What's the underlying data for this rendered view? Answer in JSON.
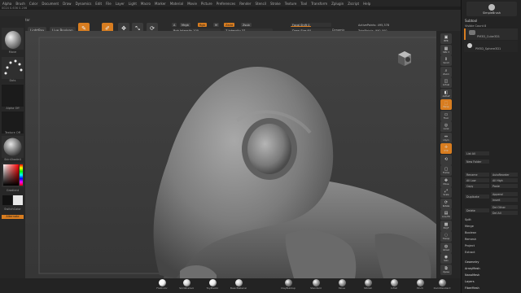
{
  "menubar": [
    "Alpha",
    "Brush",
    "Color",
    "Document",
    "Draw",
    "Dynamics",
    "Edit",
    "File",
    "Layer",
    "Light",
    "Macro",
    "Marker",
    "Material",
    "Movie",
    "Picture",
    "Preferences",
    "Render",
    "Stencil",
    "Stroke",
    "Texture",
    "Tool",
    "Transform",
    "Zplugin",
    "Zscript",
    "Help"
  ],
  "subinfo": "0024 0.636 0.206",
  "shelf": {
    "projection": "Projection Master",
    "lightbox": "LightBox",
    "live_boolean": "Live Boolean",
    "tools": [
      {
        "label": "Edit",
        "icon": "✎",
        "on": true
      },
      {
        "label": "Draw",
        "icon": "✐",
        "on": true
      },
      {
        "label": "Move",
        "icon": "✥",
        "on": false
      },
      {
        "label": "Scale",
        "icon": "⤡",
        "on": false
      },
      {
        "label": "Rotate",
        "icon": "⟳",
        "on": false
      }
    ],
    "mrgb": "Mrgb",
    "rgb": "Rgb",
    "m": "M",
    "zadd": "Zadd",
    "zsub": "Zsub",
    "a": "A",
    "rgb_intensity": "Rgb Intensity 100",
    "z_intensity": "Z Intensity 37",
    "focal_shift": "Focal Shift 0",
    "draw_size": "Draw Size 64",
    "active_points": "ActivePoints: 495,378",
    "total_points": "TotalPoints: 990,000",
    "dynamic": "Dynamic"
  },
  "left": {
    "brush": "Move",
    "stroke": "Dots",
    "alpha": "Alpha Off",
    "texture": "Texture Off",
    "material": "SkinShade4",
    "gradient": "Gradient",
    "switch_color": "SwitchColor",
    "alternate": "Alternate"
  },
  "right_shelf": [
    {
      "label": "BPR",
      "icon": "▣",
      "on": false
    },
    {
      "label": "SPix 3",
      "icon": "▦",
      "on": false
    },
    {
      "label": "Scroll",
      "icon": "⇕",
      "on": false
    },
    {
      "label": "Zoom",
      "icon": "⌕",
      "on": false
    },
    {
      "label": "Actual",
      "icon": "◫",
      "on": false
    },
    {
      "label": "AAHalf",
      "icon": "◧",
      "on": false
    },
    {
      "label": "Persp",
      "icon": "⬚",
      "on": true
    },
    {
      "label": "Floor",
      "icon": "▭",
      "on": false
    },
    {
      "label": "Local",
      "icon": "◎",
      "on": false
    },
    {
      "label": "LSym",
      "icon": "⇔",
      "on": false
    },
    {
      "label": "XYZ",
      "icon": "✛",
      "on": true
    },
    {
      "label": "",
      "icon": "⟲",
      "on": false
    },
    {
      "label": "Frame",
      "icon": "▢",
      "on": false
    },
    {
      "label": "Move",
      "icon": "✥",
      "on": false
    },
    {
      "label": "Scale",
      "icon": "⤢",
      "on": false
    },
    {
      "label": "Rotate",
      "icon": "⟳",
      "on": false
    },
    {
      "label": "Line Fill",
      "icon": "▤",
      "on": false
    },
    {
      "label": "PolyF",
      "icon": "▩",
      "on": false
    },
    {
      "label": "Transp",
      "icon": "◌",
      "on": false
    },
    {
      "label": "Ghost",
      "icon": "◍",
      "on": false
    },
    {
      "label": "Solo",
      "icon": "◉",
      "on": false
    },
    {
      "label": "Xpose",
      "icon": "⧉",
      "on": false
    }
  ],
  "tray": {
    "header": "SimpleBrush",
    "subtool": "Subtool",
    "visible_count": "Visible Count 8",
    "items": [
      "PM3D_Cube3D1",
      "PM3D_Sphere3D1"
    ],
    "list_all": "List All",
    "new_folder": "New Folder",
    "rename": "Rename",
    "auto_reorder": "AutoReorder",
    "all_low": "All Low",
    "all_high": "All High",
    "copy": "Copy",
    "paste": "Paste",
    "duplicate": "Duplicate",
    "append": "Append",
    "insert": "Insert",
    "delete": "Delete",
    "del_other": "Del Other",
    "del_all": "Del All",
    "split": "Split",
    "merge": "Merge",
    "boolean": "Boolean",
    "remesh": "Remesh",
    "project": "Project",
    "extract": "Extract",
    "sections": [
      "Geometry",
      "ArrayMesh",
      "NanoMesh",
      "Layers",
      "FiberMesh"
    ]
  },
  "bottom": [
    {
      "label": "FlatColor",
      "color": "#f2f2f2"
    },
    {
      "label": "SkinShade4",
      "color": "#cfcfcf"
    },
    {
      "label": "ToyPlastic",
      "color": "#e8e8e8"
    },
    {
      "label": "BasicMaterial",
      "color": "#cccccc"
    },
    {
      "label": "ClayBuildup",
      "color": "#8a8a8a"
    },
    {
      "label": "Standard",
      "color": "#999999"
    },
    {
      "label": "Move",
      "color": "#9a9a9a"
    },
    {
      "label": "hPolish",
      "color": "#8f8f8f"
    },
    {
      "label": "Inflat",
      "color": "#a0a0a0"
    },
    {
      "label": "Pinch",
      "color": "#979797"
    },
    {
      "label": "DamStandard",
      "color": "#8c8c8c"
    }
  ]
}
